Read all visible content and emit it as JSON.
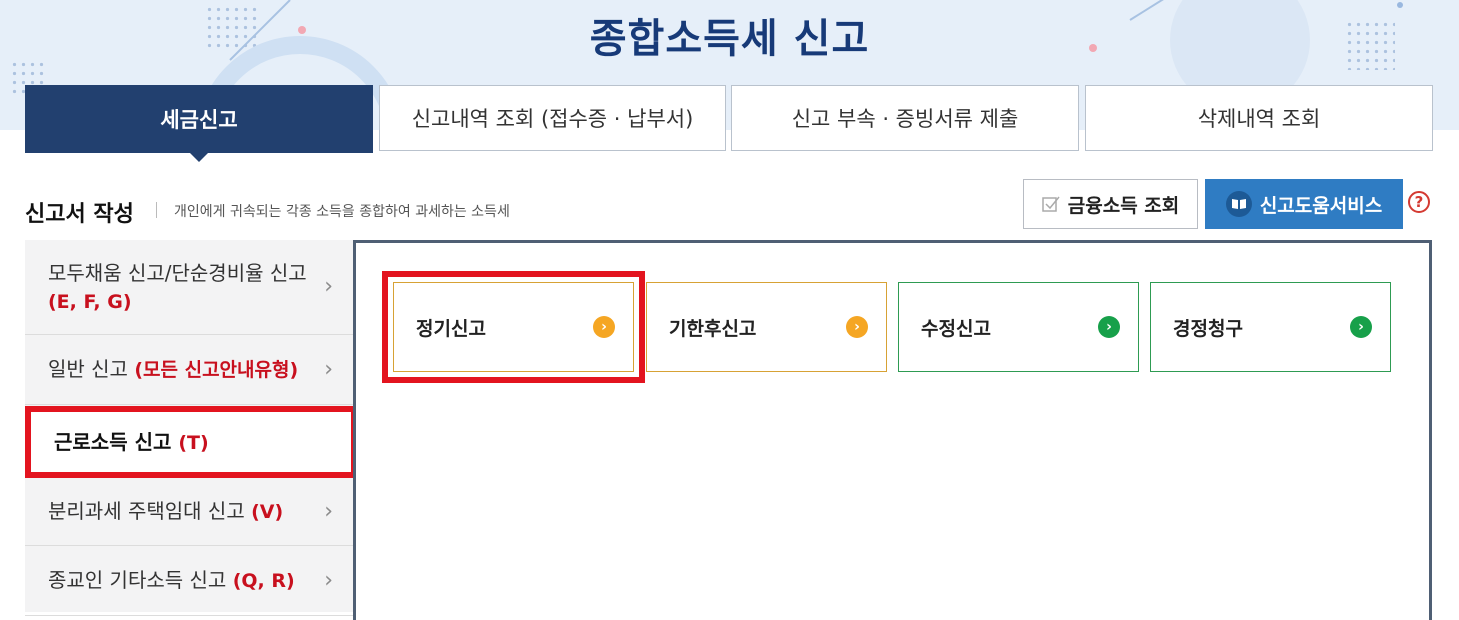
{
  "header": {
    "title": "종합소득세 신고"
  },
  "tabs": [
    {
      "label": "세금신고",
      "active": true
    },
    {
      "label": "신고내역 조회 (접수증 · 납부서)",
      "active": false
    },
    {
      "label": "신고 부속 · 증빙서류 제출",
      "active": false
    },
    {
      "label": "삭제내역 조회",
      "active": false
    }
  ],
  "section": {
    "title": "신고서 작성",
    "description": "개인에게 귀속되는 각종 소득을 종합하여 과세하는 소득세",
    "finance_button": "금융소득 조회",
    "help_service_button": "신고도움서비스",
    "help_icon": "?"
  },
  "sidemenu": [
    {
      "label": "모두채움 신고/단순경비율 신고",
      "code": "(E, F, G)"
    },
    {
      "label": "일반 신고",
      "code": "(모든 신고안내유형)"
    },
    {
      "label": "근로소득 신고",
      "code": "(T)",
      "selected": true
    },
    {
      "label": "분리과세 주택임대 신고",
      "code": "(V)"
    },
    {
      "label": "종교인 기타소득 신고",
      "code": "(Q, R)"
    }
  ],
  "cards": [
    {
      "label": "정기신고",
      "color": "#f5a623"
    },
    {
      "label": "기한후신고",
      "color": "#f5a623"
    },
    {
      "label": "수정신고",
      "color": "#17a04a"
    },
    {
      "label": "경정청구",
      "color": "#17a04a"
    }
  ],
  "colors": {
    "primary_navy": "#22406f",
    "title_blue": "#173a78",
    "help_blue": "#2f7cc3",
    "highlight_red": "#e3141f",
    "code_red": "#c8101e"
  }
}
